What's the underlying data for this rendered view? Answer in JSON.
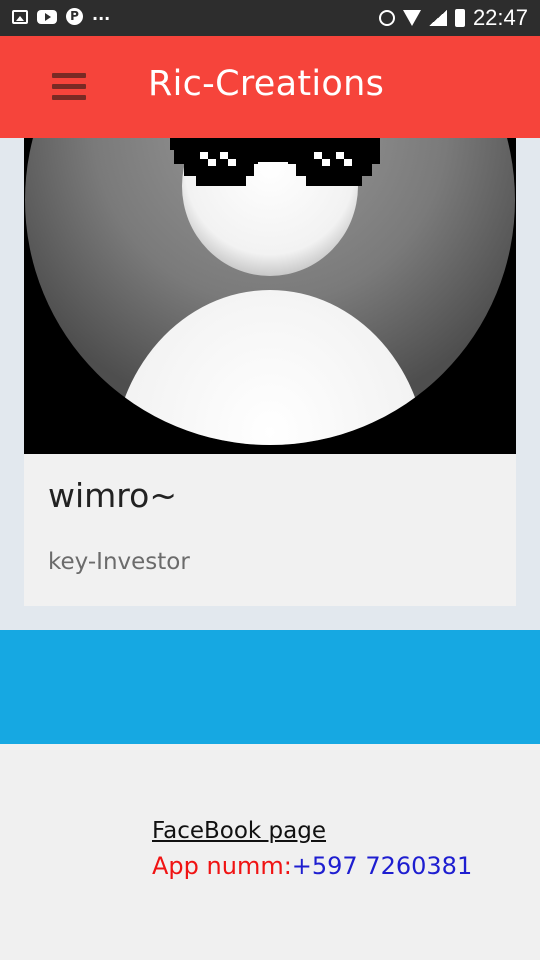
{
  "status_bar": {
    "icons": [
      "gallery-icon",
      "youtube-icon",
      "pinterest-icon",
      "more-notifications-icon",
      "alarm-icon",
      "wifi-icon",
      "signal-icon",
      "battery-icon"
    ],
    "overflow_dots": "...",
    "pinterest_glyph": "P",
    "time": "22:47"
  },
  "app_bar": {
    "title": "Ric-Creations",
    "background": "#f6443b",
    "menu_icon": "hamburger-menu-icon"
  },
  "profile_card": {
    "avatar_icon": "avatar-with-pixel-sunglasses",
    "name": "wimro~",
    "role": "key-Investor"
  },
  "blue_band": {
    "color": "#16a8e2"
  },
  "footer": {
    "facebook_link": "FaceBook page",
    "app_number_label": "App numm:",
    "app_number_value": "+597 7260381",
    "label_color": "#f01313",
    "value_color": "#1e1ed0"
  }
}
